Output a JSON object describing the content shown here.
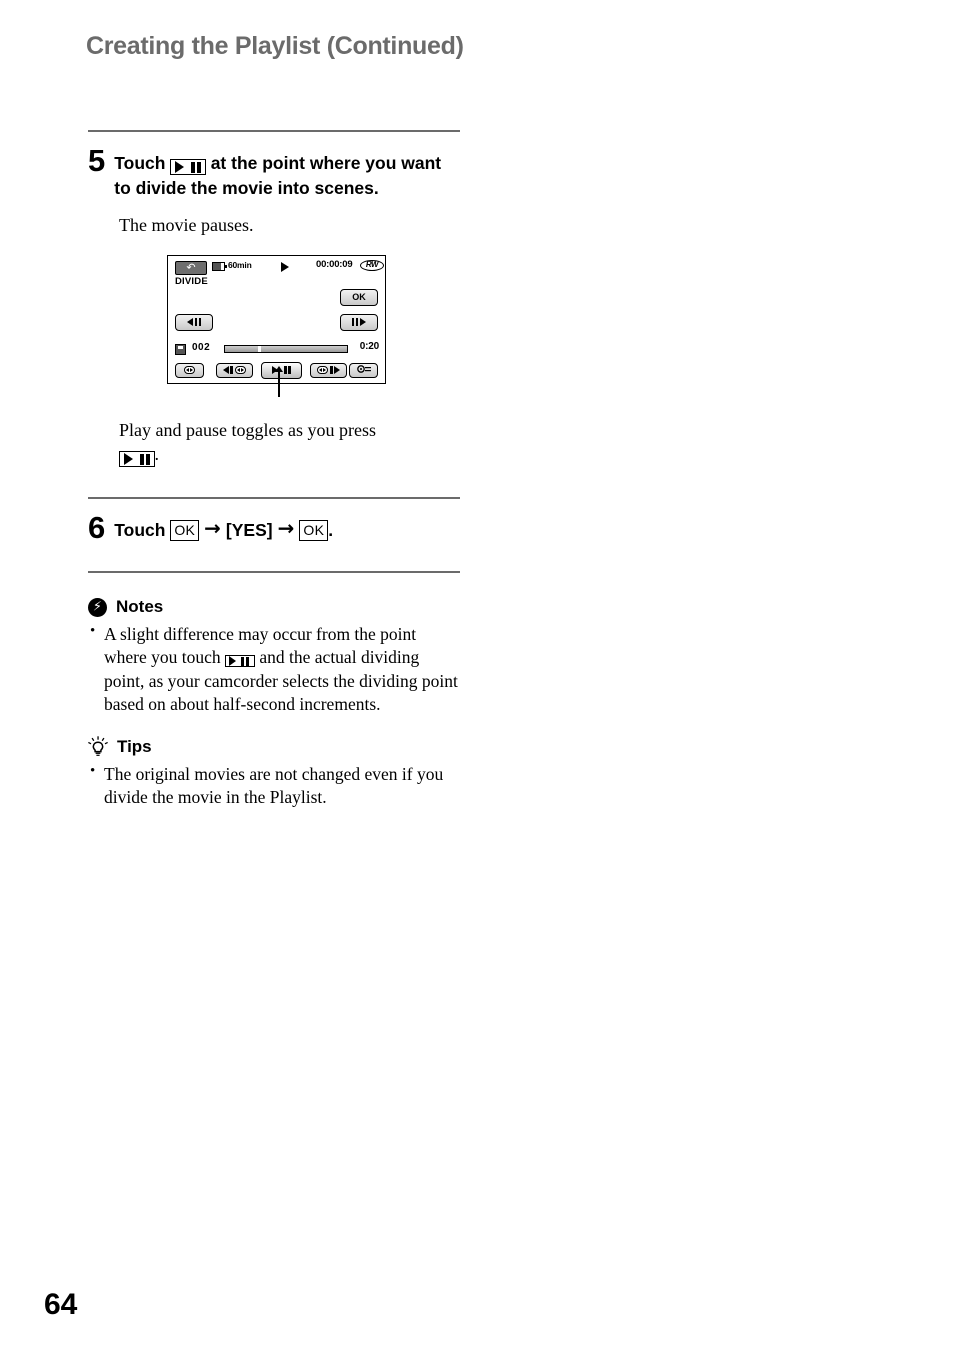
{
  "page": {
    "running_head": "Creating the Playlist (Continued)",
    "folio": "64"
  },
  "steps": [
    {
      "number": "5",
      "text_before_icon": "Touch",
      "icon": "play-pause-icon",
      "text_after_icon": "at the point where you want to divide the movie into scenes.",
      "result_text": "The movie pauses.",
      "caption_text": "Play and pause toggles as you press",
      "caption_suffix": "."
    },
    {
      "number": "6",
      "touch_label": "Touch",
      "ok_label_1": "OK",
      "arrow_1": "→",
      "yes_label": "[YES]",
      "arrow_2": "→",
      "ok_label_2": "OK",
      "period": "."
    }
  ],
  "lcd": {
    "back_icon": "return-arrow-icon",
    "battery_icon": "battery-icon",
    "battery_time": "60min",
    "play_indicator": "play-triangle-icon",
    "timecode": "00:00:09",
    "disc_type": "RW",
    "mode_title": "DIVIDE",
    "ok_button": "OK",
    "frame_back_button": "◀II",
    "frame_fwd_button": "II▶",
    "scene_icon": "movie-file-icon",
    "scene_number": "002",
    "progress_percent": 27,
    "duration": "0:20",
    "bottom_buttons": [
      "prev-scene-button",
      "rewind-scene-button",
      "play-pause-button",
      "forward-scene-button",
      "options-menu-button"
    ]
  },
  "notes": {
    "icon": "notes-bolt-icon",
    "heading": "Notes",
    "items_pre": "A slight difference may occur from the point where you touch",
    "items_post": "and the actual dividing point, as your camcorder selects the dividing point based on about half-second increments."
  },
  "tips": {
    "icon": "tips-lightbulb-icon",
    "heading": "Tips",
    "items": [
      "The original movies are not changed even if you divide the movie in the Playlist."
    ]
  }
}
